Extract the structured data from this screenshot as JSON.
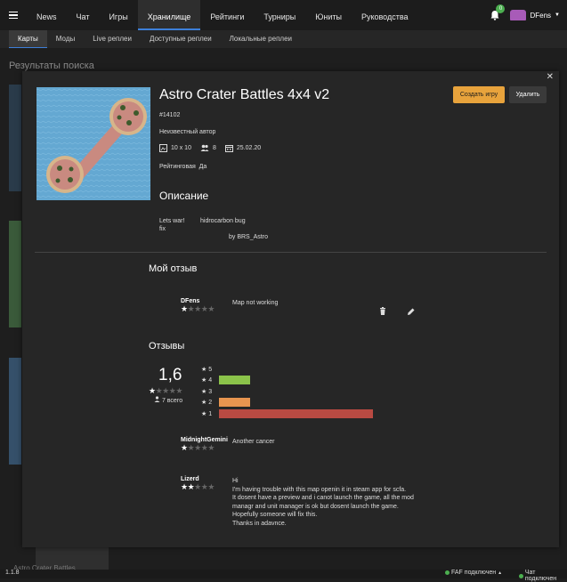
{
  "nav": {
    "items": [
      "News",
      "Чат",
      "Игры",
      "Хранилище",
      "Рейтинги",
      "Турниры",
      "Юниты",
      "Руководства"
    ],
    "active_index": 3,
    "notification_count": "0",
    "username": "DFens"
  },
  "subnav": {
    "items": [
      "Карты",
      "Моды",
      "Live реплеи",
      "Доступные реплеи",
      "Локальные реплеи"
    ],
    "active_index": 0
  },
  "background": {
    "results_title": "Результаты поиска",
    "tile_label": "Astro Crater Battles"
  },
  "status": {
    "version": "1.1.8",
    "faf": "FAF подключен",
    "chat": "Чат подключен"
  },
  "map": {
    "title": "Astro Crater Battles 4x4 v2",
    "id": "#14102",
    "author": "Неизвестный автор",
    "size": "10 x 10",
    "players": "8",
    "date": "25.02.20",
    "rated_label": "Рейтинговая",
    "rated_value": "Да",
    "create_button": "Создать игру",
    "delete_button": "Удалить"
  },
  "description": {
    "heading": "Описание",
    "col1_line1": "Lets war!",
    "col1_line2": "fix",
    "col2_line1": "hidrocarbon bug",
    "col2_line2": "by BRS_Astro"
  },
  "my_review": {
    "heading": "Мой отзыв",
    "user": "DFens",
    "rating": 1,
    "text": "Map not working"
  },
  "reviews": {
    "heading": "Отзывы",
    "average": "1,6",
    "average_stars": 1,
    "total": "7 всего",
    "distribution": [
      {
        "stars": "5",
        "count": 0,
        "color": "#8bc34a"
      },
      {
        "stars": "4",
        "count": 1,
        "color": "#8bc34a"
      },
      {
        "stars": "3",
        "count": 0,
        "color": "#e8954f"
      },
      {
        "stars": "2",
        "count": 1,
        "color": "#e8954f"
      },
      {
        "stars": "1",
        "count": 5,
        "color": "#b94a42"
      }
    ],
    "items": [
      {
        "user": "MidnightGemini",
        "rating": 1,
        "lines": [
          "Another cancer"
        ]
      },
      {
        "user": "Lizerd",
        "rating": 2,
        "lines": [
          "Hi",
          "I'm having trouble with this map openin it in steam app for scfa.",
          "It dosent have a preview and i canot launch the game, all the mod",
          "managr and unit manager is ok but dosent launch the game.",
          "Hopefully someone will fix this.",
          "Thanks in adavnce."
        ]
      }
    ]
  }
}
